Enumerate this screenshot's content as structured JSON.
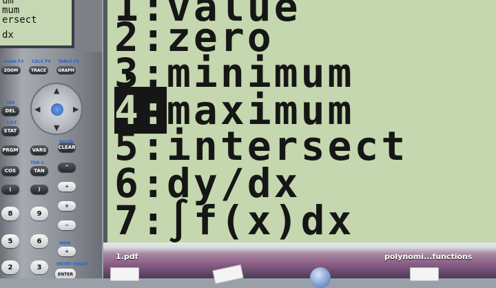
{
  "mini_screen": {
    "lines": [
      "um",
      "mum",
      "ersect",
      "dx"
    ]
  },
  "function_keys": [
    {
      "above": "",
      "label": "ZOOM",
      "fn": "F2"
    },
    {
      "above": "CALC",
      "label": "TRACE",
      "fn": "F4"
    },
    {
      "above": "TABLE",
      "label": "GRAPH",
      "fn": "F5"
    }
  ],
  "fkey_top_labels": [
    "zoom F3",
    "CALC F4",
    "TABLE F5"
  ],
  "calc_keys": {
    "ins": "INS",
    "del": "DEL",
    "list": "LIST",
    "stat": "STAT",
    "distr": "DISTR",
    "prgm": "PRGM",
    "vars": "VARS",
    "clear": "CLEAR",
    "tan_inv": "TAN-1",
    "cos": "COS",
    "tan": "TAN",
    "power": "^",
    "divide": "÷",
    "multiply": "×",
    "minus": "−",
    "plus": "+",
    "n8": "8",
    "n9": "9",
    "n5": "5",
    "n6": "6",
    "n2": "2",
    "n3": "3",
    "mem": "MEM",
    "entry_solve": "ENTRY SOLVE",
    "enter": "ENTER"
  },
  "menu": {
    "items": [
      {
        "num": "1:",
        "label": "value"
      },
      {
        "num": "2:",
        "label": "zero"
      },
      {
        "num": "3:",
        "label": "minimum"
      },
      {
        "num": "4:",
        "label": "maximum",
        "selected": true
      },
      {
        "num": "5:",
        "label": "intersect"
      },
      {
        "num": "6:",
        "label": "dy/dx"
      },
      {
        "num": "7:",
        "label": "∫f(x)dx"
      }
    ]
  },
  "desktop": {
    "file1": "1.pdf",
    "file2": "polynomi...functions"
  },
  "colors": {
    "lcd": "#c4d7ae",
    "lcd_text": "#161616",
    "blue_label": "#2a62c7",
    "green_label": "#2d8d4b"
  }
}
